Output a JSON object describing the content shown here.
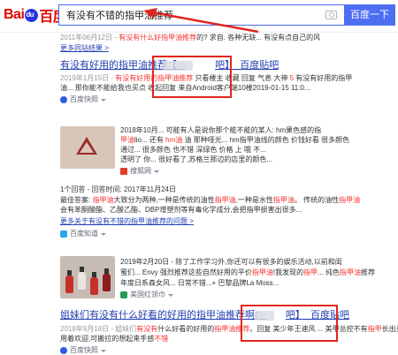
{
  "header": {
    "logo_bai": "Bai",
    "logo_du": "百度",
    "query": "有没有不错的指甲油推荐",
    "search_button": "百度一下"
  },
  "results": [
    {
      "snippet_pre": "2011年06月12日 - ",
      "snippet_hl": "有没有什么好指甲油推荐",
      "snippet_post": "的? 求自. 各种无缺... 有没有点自己的风",
      "source": "更多同站结果 >"
    },
    {
      "title_a": "有没有好用的指甲油推荐【",
      "title_blur": "m",
      "title_b": "吧】_百度贴吧",
      "line1_a": "2019年1月15日 - ",
      "line1_r": "有没有好用的指甲油推荐",
      "line1_b": " 只看楼主 收藏 回复 气息 大神 ",
      "line1_r2": "5",
      "line1_c": " 有没有好用的指甲",
      "line2": "油... 那你能不能给我也买点 收起回复 来自Android客户端10楼2019-01-15 11:0...",
      "source": "百度快照"
    },
    {
      "line1": "2018年10月... 可能有人是说你那个能不能的某人: hm果色感的指",
      "line2_a": "甲油",
      "line2_b": "lio... 还有 ",
      "line2_r": "hm油",
      "line2_c": " 油 那种哑光... hm指甲油线的颜色 价钱好看 很多颜色",
      "line3": "通过... 很多颜色 也不错 深绿色 价格 上 哦 不...",
      "line4": "透明了 你... 很好看了,苏格兰那边的店里的颜色...",
      "source": "搜狐网"
    },
    {
      "line0": "1个回答 - 回答时间: 2017年11月24日",
      "line1_a": "最佳答案: ",
      "line1_r": "指甲油",
      "line1_b": "大致分为两种,一种是传统的油性",
      "line1_r2": "指甲油",
      "line1_c": ",一种是水性",
      "line1_r3": "指甲油",
      "line1_d": "。 传统的油性",
      "line1_r4": "指甲油",
      "line2": "会有苯酮酸酯、乙酸乙酯、DBP增塑剂等有毒化学成分,会把指甲损害出很多...",
      "line3": "更多关于有没有不错的指甲油推荐的问题 >",
      "source": "百度知道"
    },
    {
      "line1": "2019年2月20日 - 除了工作学习外,你还可以有很多的娱乐活动,以前和闺",
      "line2_a": "蜜们... Envy 强烈推荐这些自然好用的平价",
      "line2_r": "指甲油",
      "line2_b": "!我发现的",
      "line2_r2": "指甲",
      "line2_c": "... 纯色",
      "line2_r3": "指甲油",
      "line2_d": "推荐",
      "line3": "年度日系森女风... 日常不错...+ 巴黎品牌La Moss...",
      "source": "美国红领巾"
    },
    {
      "title_a": "姐妹们有没有什么好看的好用的指甲油推荐啊(",
      "title_blur": "m",
      "title_b": "吧】_百度贴吧",
      "line1_a": "2018年9月18日 - 姐妹们",
      "line1_r": "有没有",
      "line1_b": "什么好看",
      "line1_c": "的好用的",
      "line1_r2": "指甲油推荐",
      "line1_d": "。回复 美少年王速风 ... 美甲总控不有",
      "line1_r3": "指甲",
      "line1_e": "长出头了",
      "line2_a": "用着欢迎,可搬拉的",
      "line2_b": "想起来手感",
      "line2_r": "不错",
      "source": "百度快照"
    }
  ],
  "colors": {
    "accent": "#4e6ef2",
    "title_link": "#2440b3",
    "keyword_red": "#f73131",
    "annotation": "#e0261c"
  }
}
